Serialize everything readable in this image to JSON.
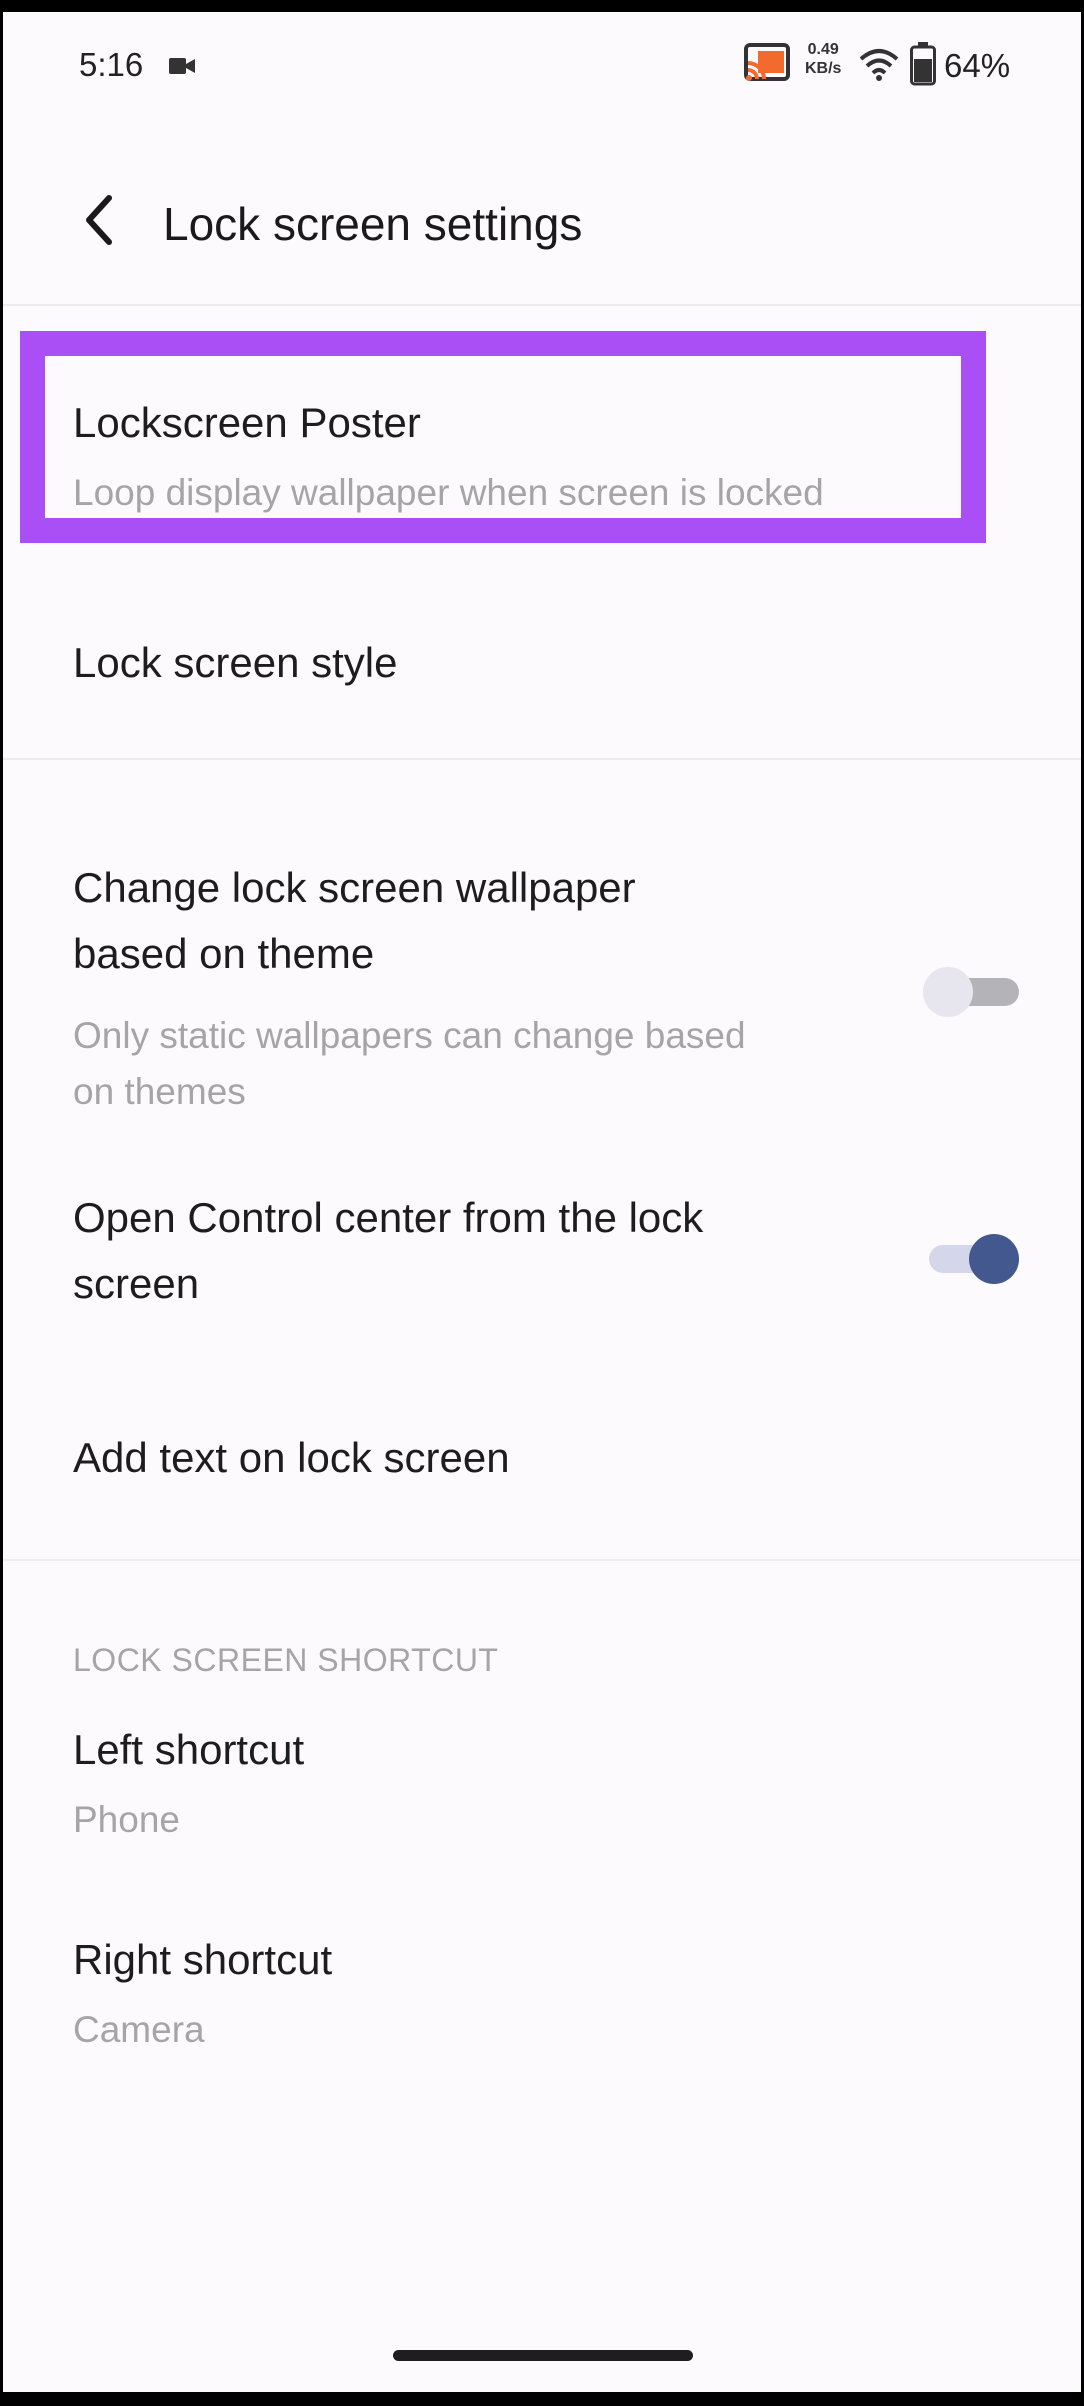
{
  "status_bar": {
    "time": "5:16",
    "net_speed_value": "0.49",
    "net_speed_unit": "KB/s",
    "battery": "64%",
    "cast_color": "#f26a2e"
  },
  "header": {
    "title": "Lock screen settings"
  },
  "settings": {
    "lockscreen_poster": {
      "title": "Lockscreen Poster",
      "subtitle": "Loop display wallpaper when screen is locked"
    },
    "lock_screen_style": {
      "title": "Lock screen style"
    },
    "change_wallpaper_theme": {
      "title_line1": "Change lock screen wallpaper",
      "title_line2": "based on theme",
      "subtitle_line1": "Only static wallpapers can change based",
      "subtitle_line2": "on themes",
      "enabled": false
    },
    "open_control_center": {
      "title_line1": "Open Control center from the lock",
      "title_line2": "screen",
      "enabled": true
    },
    "add_text": {
      "title": "Add text on lock screen"
    }
  },
  "shortcut_section": {
    "header": "LOCK SCREEN SHORTCUT",
    "left": {
      "title": "Left shortcut",
      "value": "Phone"
    },
    "right": {
      "title": "Right shortcut",
      "value": "Camera"
    }
  },
  "colors": {
    "highlight": "#a94ff5",
    "toggle_on": "#43588f"
  }
}
